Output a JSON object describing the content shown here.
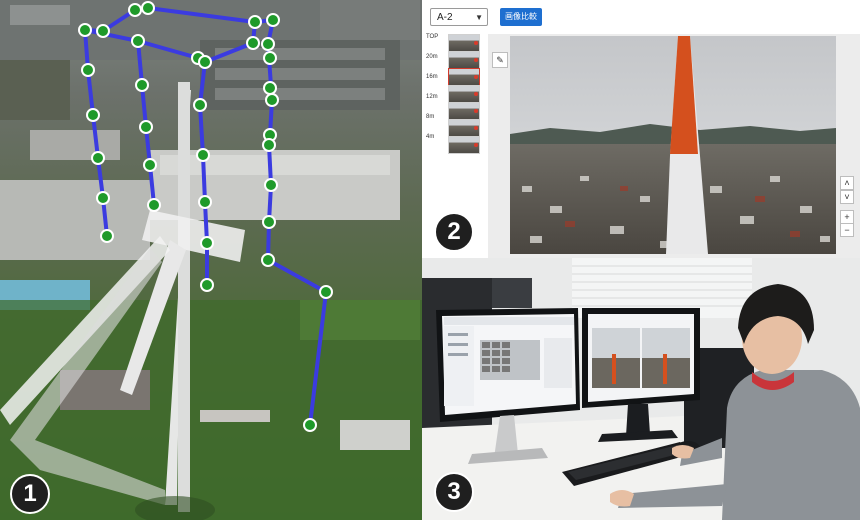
{
  "badges": {
    "one": "1",
    "two": "2",
    "three": "3"
  },
  "tool": {
    "site_selector_value": "A-2",
    "compare_button_label": "画像比較",
    "altitude_labels": [
      "TOP",
      "20m",
      "16m",
      "12m",
      "8m",
      "4m"
    ],
    "selected_altitude": "16m"
  },
  "colors": {
    "flight_path": "#3b3be0",
    "waypoint": "#1f9a2a",
    "accent_button": "#1e6fd0",
    "blade_tip": "#d4501e"
  },
  "icons": {
    "edit": "pencil-icon",
    "up": "chevron-up-icon",
    "down": "chevron-down-icon",
    "zoom_in": "plus-icon",
    "zoom_out": "minus-icon"
  }
}
